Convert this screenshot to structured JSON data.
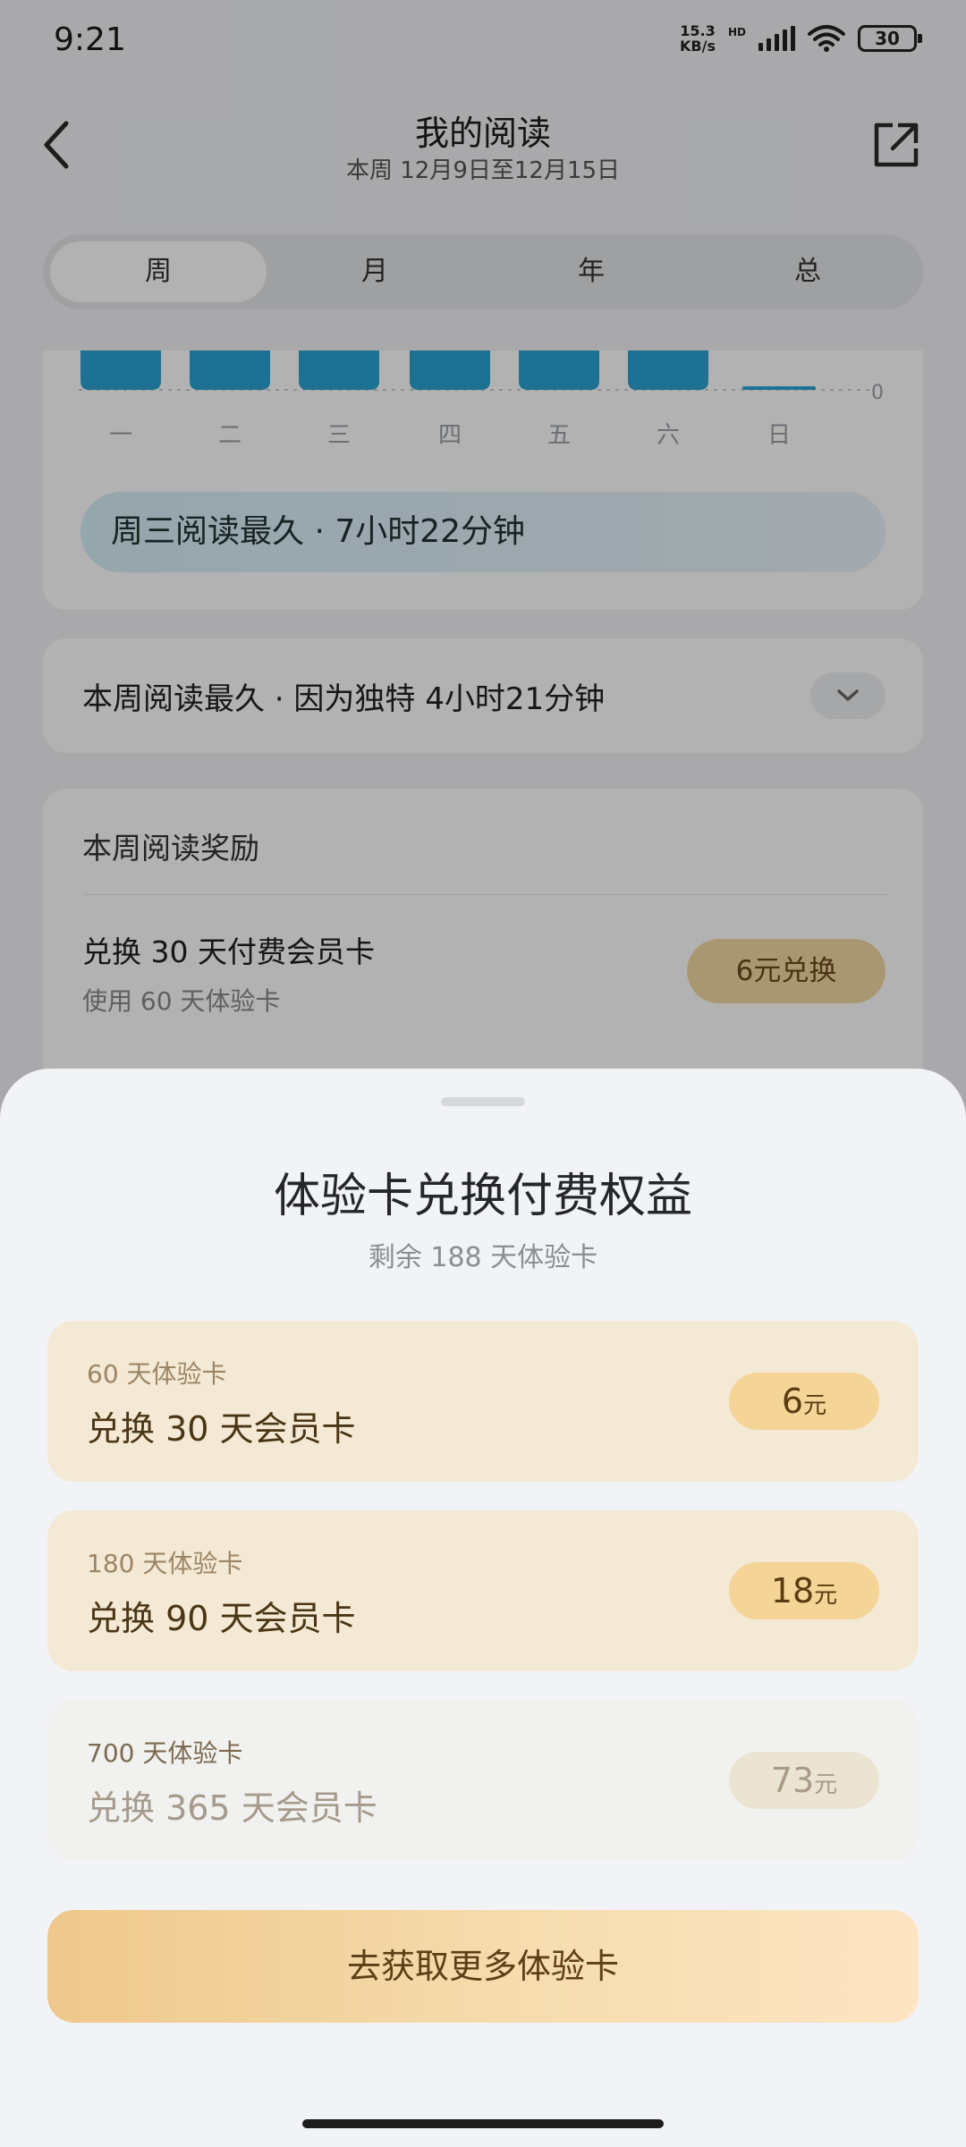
{
  "status_bar": {
    "time": "9:21",
    "net_speed_value": "15.3",
    "net_speed_unit": "KB/s",
    "hd_label": "HD",
    "battery": "30"
  },
  "header": {
    "title": "我的阅读",
    "subtitle": "本周 12月9日至12月15日",
    "back_icon": "chevron-left-icon",
    "share_icon": "share-icon"
  },
  "period_tabs": [
    {
      "label": "周",
      "active": true
    },
    {
      "label": "月",
      "active": false
    },
    {
      "label": "年",
      "active": false
    },
    {
      "label": "总",
      "active": false
    }
  ],
  "week_chart": {
    "days": [
      "一",
      "二",
      "三",
      "四",
      "五",
      "六",
      "日"
    ],
    "zero_label": "0",
    "bar_color": "#2aa4d4",
    "highlight": "周三阅读最久 · 7小时22分钟"
  },
  "most_read": {
    "text": "本周阅读最久 · 因为独特 4小时21分钟",
    "expand_icon": "chevron-down-icon"
  },
  "reward": {
    "title": "本周阅读奖励",
    "item_title": "兑换 30 天付费会员卡",
    "item_sub": "使用 60 天体验卡",
    "button_label": "6元兑换"
  },
  "sheet": {
    "title": "体验卡兑换付费权益",
    "subtitle": "剩余 188 天体验卡",
    "options": [
      {
        "cost": "60 天体验卡",
        "name": "兑换 30 天会员卡",
        "price": "6",
        "unit": "元"
      },
      {
        "cost": "180 天体验卡",
        "name": "兑换 90 天会员卡",
        "price": "18",
        "unit": "元"
      },
      {
        "cost": "700 天体验卡",
        "name": "兑换 365 天会员卡",
        "price": "73",
        "unit": "元"
      }
    ],
    "cta_label": "去获取更多体验卡"
  }
}
